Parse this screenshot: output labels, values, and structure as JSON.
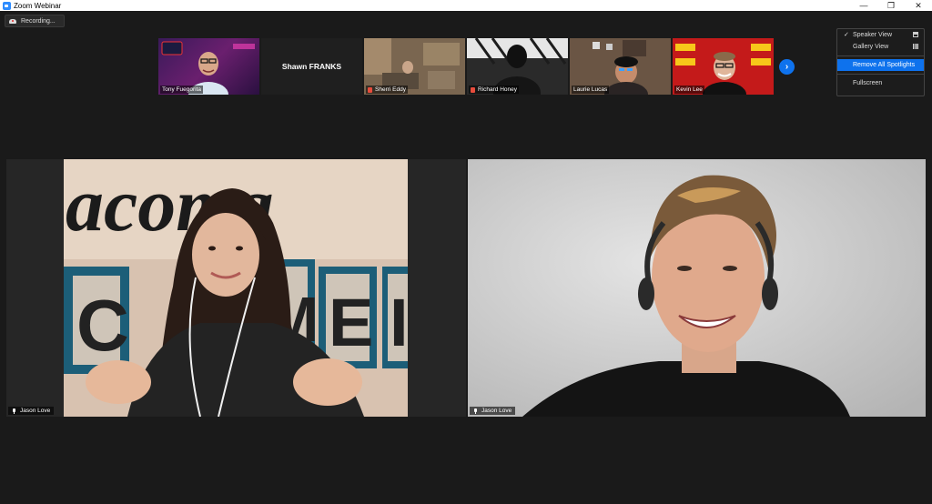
{
  "window": {
    "title": "Zoom Webinar",
    "minimize": "—",
    "maximize": "❐",
    "close": "✕"
  },
  "recording": {
    "label": "Recording..."
  },
  "thumbnails": [
    {
      "name": "Tony Fuegorita"
    },
    {
      "name": "Shawn FRANKS"
    },
    {
      "name": "Sherri Eddy"
    },
    {
      "name": "Richard Honey"
    },
    {
      "name": "Laurie Lucas"
    },
    {
      "name": "Kevin Lee"
    }
  ],
  "thumb_strip": {
    "next_arrow": "›"
  },
  "view_menu": {
    "items": [
      {
        "label": "Speaker View",
        "checked": "✓"
      },
      {
        "label": "Gallery View"
      },
      {
        "label": "Remove All Spotlights"
      },
      {
        "label": "Fullscreen"
      }
    ]
  },
  "videos": {
    "left": {
      "name": "Jason Love",
      "backdrop_text": "acoma",
      "letters": [
        "C",
        "M",
        "E",
        "I"
      ]
    },
    "right": {
      "name": "Jason Love"
    }
  },
  "colors": {
    "accent": "#0e72ed",
    "background": "#1a1a1a"
  }
}
